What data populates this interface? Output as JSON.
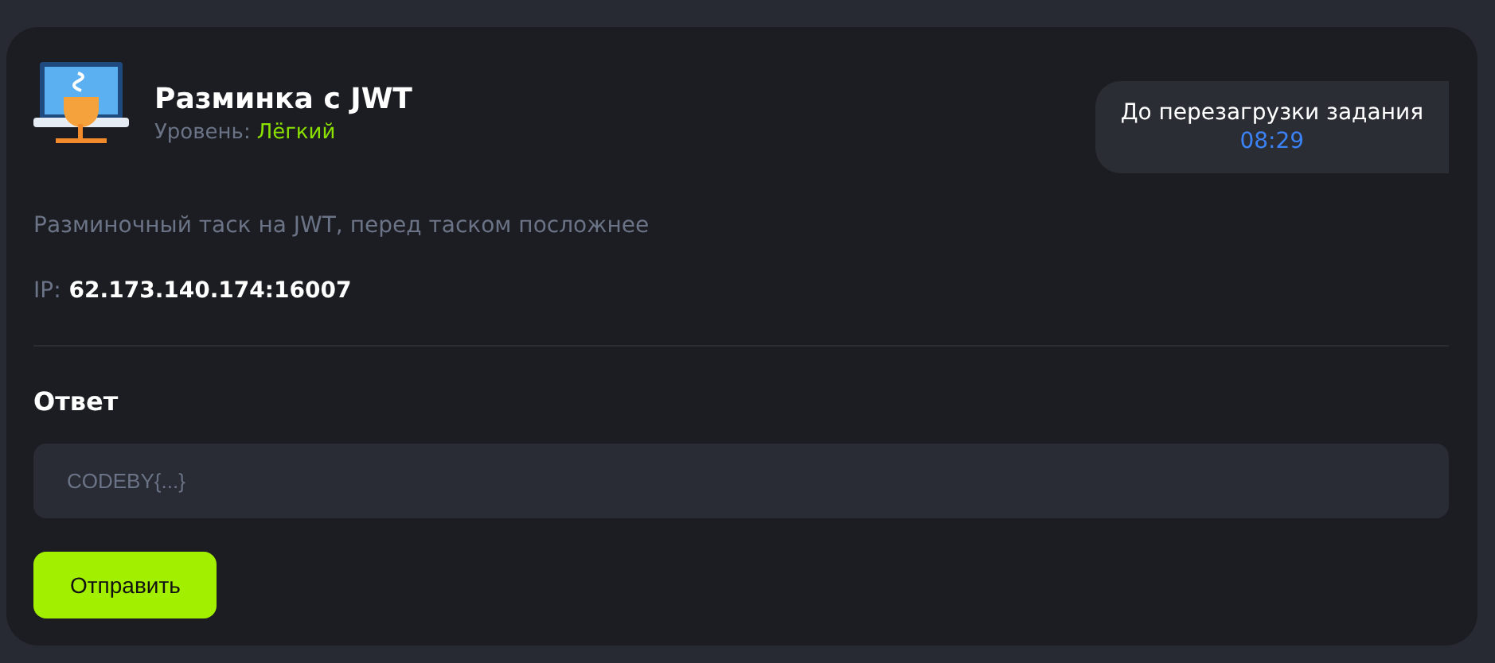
{
  "task": {
    "title": "Разминка с JWT",
    "level_label": "Уровень:",
    "level_value": "Лёгкий",
    "description": "Разминочный таск на JWT, перед таском посложнее",
    "ip_label": "IP:",
    "ip_value": "62.173.140.174:16007"
  },
  "timer": {
    "label": "До перезагрузки задания",
    "value": "08:29"
  },
  "answer": {
    "heading": "Ответ",
    "placeholder": "CODEBY{...}",
    "button": "Отправить"
  }
}
